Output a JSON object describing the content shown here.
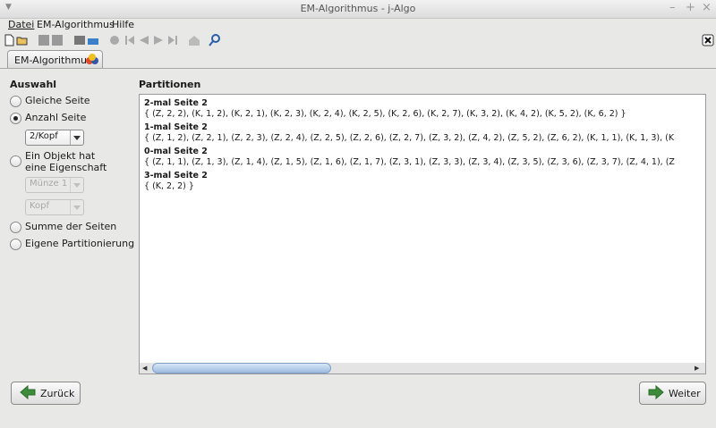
{
  "window": {
    "title": "EM-Algorithmus  -  j-Algo"
  },
  "menu": {
    "datei": "Datei",
    "em": "EM-Algorithmus",
    "hilfe": "Hilfe"
  },
  "tab": {
    "label": "EM-Algorithmus"
  },
  "auswahl": {
    "heading": "Auswahl",
    "options": [
      "Gleiche Seite",
      "Anzahl Seite",
      "Ein Objekt hat eine Eigenschaft",
      "Summe der Seiten",
      "Eigene Partitionierung"
    ],
    "option3_line1": "Ein Objekt hat",
    "option3_line2": "eine Eigenschaft",
    "combo_anzahl": "2/Kopf",
    "combo_muenze": "Münze 1",
    "combo_kopf": "Kopf"
  },
  "partitionen": {
    "heading": "Partitionen",
    "groups": [
      {
        "title": "2-mal Seite 2",
        "set": "{ (Z, 2, 2), (K, 1, 2), (K, 2, 1), (K, 2, 3), (K, 2, 4), (K, 2, 5), (K, 2, 6), (K, 2, 7), (K, 3, 2), (K, 4, 2), (K, 5, 2), (K, 6, 2) }"
      },
      {
        "title": "1-mal Seite 2",
        "set": "{ (Z, 1, 2), (Z, 2, 1), (Z, 2, 3), (Z, 2, 4), (Z, 2, 5), (Z, 2, 6), (Z, 2, 7), (Z, 3, 2), (Z, 4, 2), (Z, 5, 2), (Z, 6, 2), (K, 1, 1), (K, 1, 3), (K"
      },
      {
        "title": "0-mal Seite 2",
        "set": "{ (Z, 1, 1), (Z, 1, 3), (Z, 1, 4), (Z, 1, 5), (Z, 1, 6), (Z, 1, 7), (Z, 3, 1), (Z, 3, 3), (Z, 3, 4), (Z, 3, 5), (Z, 3, 6), (Z, 3, 7), (Z, 4, 1), (Z"
      },
      {
        "title": "3-mal Seite 2",
        "set": "{ (K, 2, 2) }"
      }
    ]
  },
  "nav": {
    "back": "Zurück",
    "next": "Weiter"
  },
  "colors": {
    "accent": "#3c8c3c",
    "selection_blue": "#9dbbdf"
  }
}
